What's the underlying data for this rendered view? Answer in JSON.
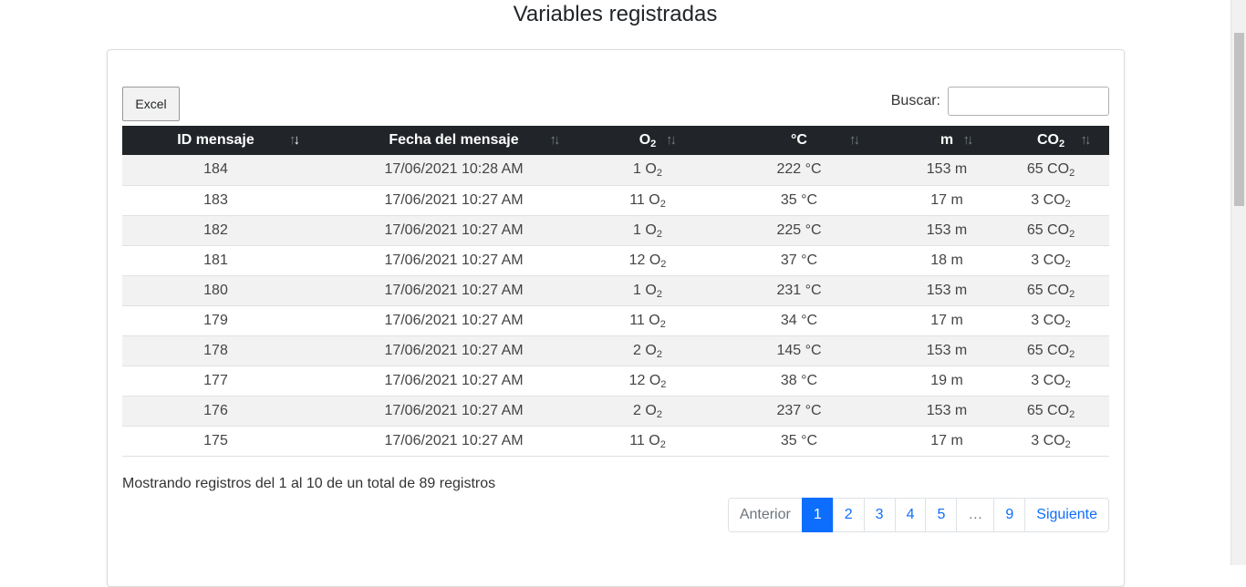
{
  "page": {
    "title": "Variables registradas"
  },
  "toolbar": {
    "excel_label": "Excel",
    "search_label": "Buscar:",
    "search_value": ""
  },
  "table": {
    "headers": [
      {
        "label": "ID mensaje",
        "sub": "",
        "sort": "desc"
      },
      {
        "label": "Fecha del mensaje",
        "sub": "",
        "sort": "none"
      },
      {
        "label": "O",
        "sub": "2",
        "sort": "none"
      },
      {
        "label": "°C",
        "sub": "",
        "sort": "none"
      },
      {
        "label": "m",
        "sub": "",
        "sort": "none"
      },
      {
        "label": "CO",
        "sub": "2",
        "sort": "none"
      }
    ],
    "rows": [
      {
        "id": "184",
        "date": "17/06/2021 10:28 AM",
        "o2": "1 O",
        "temp": "222 °C",
        "m": "153 m",
        "co2": "65 CO"
      },
      {
        "id": "183",
        "date": "17/06/2021 10:27 AM",
        "o2": "11 O",
        "temp": "35 °C",
        "m": "17 m",
        "co2": "3 CO"
      },
      {
        "id": "182",
        "date": "17/06/2021 10:27 AM",
        "o2": "1 O",
        "temp": "225 °C",
        "m": "153 m",
        "co2": "65 CO"
      },
      {
        "id": "181",
        "date": "17/06/2021 10:27 AM",
        "o2": "12 O",
        "temp": "37 °C",
        "m": "18 m",
        "co2": "3 CO"
      },
      {
        "id": "180",
        "date": "17/06/2021 10:27 AM",
        "o2": "1 O",
        "temp": "231 °C",
        "m": "153 m",
        "co2": "65 CO"
      },
      {
        "id": "179",
        "date": "17/06/2021 10:27 AM",
        "o2": "11 O",
        "temp": "34 °C",
        "m": "17 m",
        "co2": "3 CO"
      },
      {
        "id": "178",
        "date": "17/06/2021 10:27 AM",
        "o2": "2 O",
        "temp": "145 °C",
        "m": "153 m",
        "co2": "65 CO"
      },
      {
        "id": "177",
        "date": "17/06/2021 10:27 AM",
        "o2": "12 O",
        "temp": "38 °C",
        "m": "19 m",
        "co2": "3 CO"
      },
      {
        "id": "176",
        "date": "17/06/2021 10:27 AM",
        "o2": "2 O",
        "temp": "237 °C",
        "m": "153 m",
        "co2": "65 CO"
      },
      {
        "id": "175",
        "date": "17/06/2021 10:27 AM",
        "o2": "11 O",
        "temp": "35 °C",
        "m": "17 m",
        "co2": "3 CO"
      }
    ],
    "subscript": "2"
  },
  "info": {
    "text": "Mostrando registros del 1 al 10 de un total de 89 registros"
  },
  "pagination": {
    "items": [
      {
        "label": "Anterior",
        "kind": "prev"
      },
      {
        "label": "1",
        "kind": "current"
      },
      {
        "label": "2",
        "kind": "page"
      },
      {
        "label": "3",
        "kind": "page"
      },
      {
        "label": "4",
        "kind": "page"
      },
      {
        "label": "5",
        "kind": "page"
      },
      {
        "label": "…",
        "kind": "ellipsis"
      },
      {
        "label": "9",
        "kind": "page"
      },
      {
        "label": "Siguiente",
        "kind": "next"
      }
    ]
  },
  "theme": {
    "header_bg": "#212529",
    "accent": "#0d6efd",
    "stripe": "#f2f2f2"
  }
}
